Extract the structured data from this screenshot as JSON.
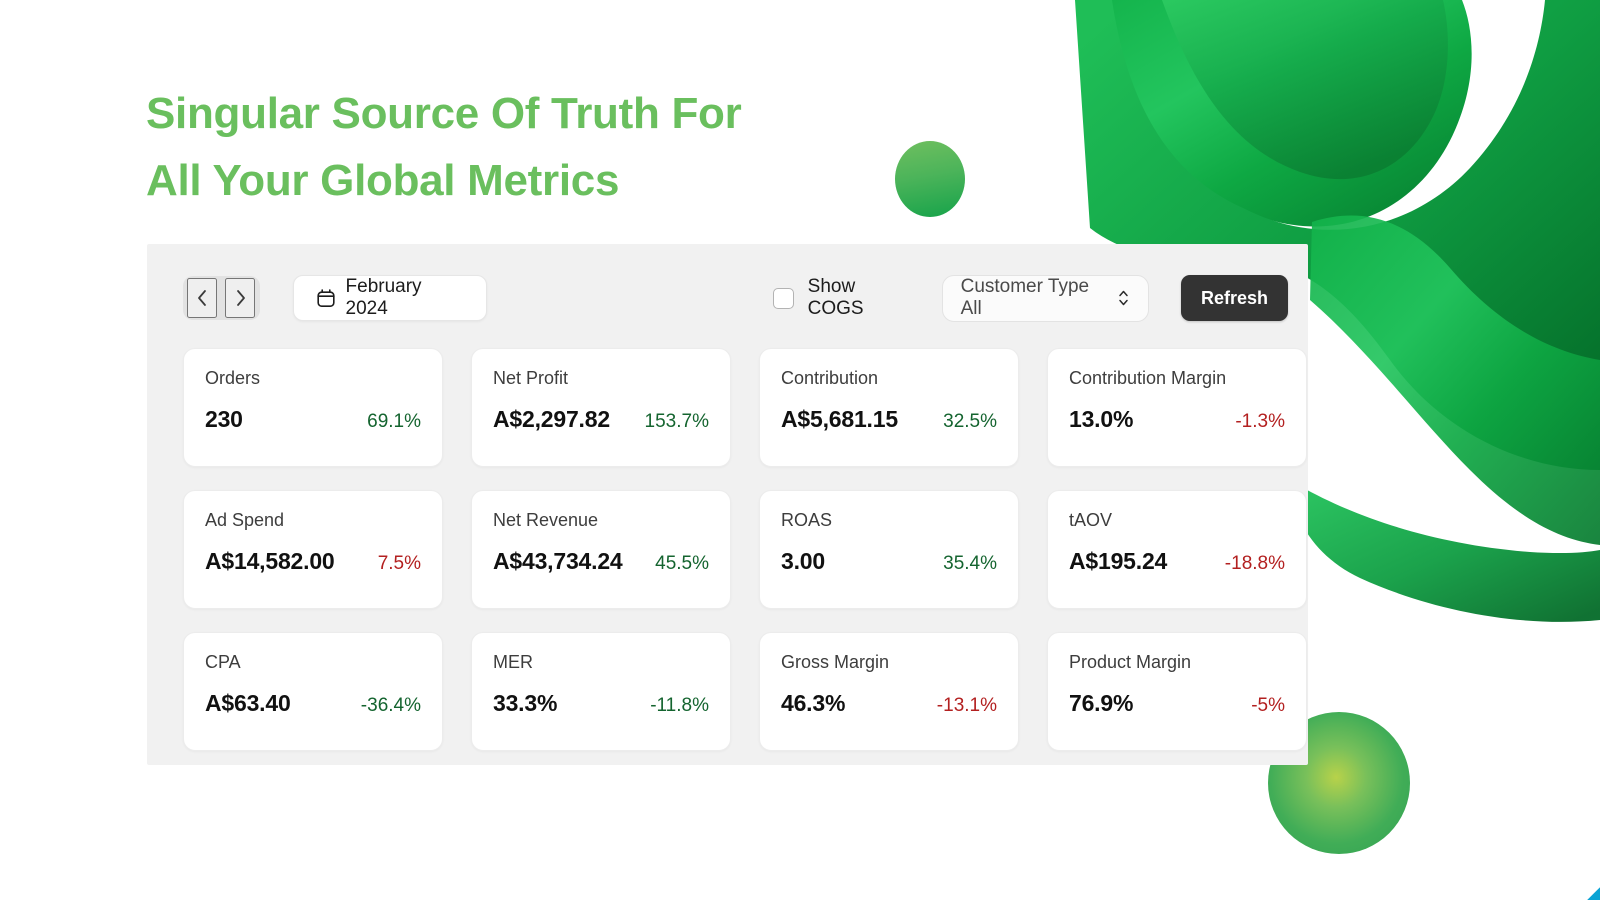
{
  "hero": {
    "headline": "Singular Source Of Truth For\nAll Your Global Metrics",
    "headline_color": "#6abf5e"
  },
  "decor": {
    "circle_small": "green-gradient-circle",
    "circle_large": "green-radial-circle",
    "ribbon": "green-wave-ribbon",
    "corner_mark": "blue-corner-fragment"
  },
  "dashboard": {
    "toolbar": {
      "prev_label": "‹",
      "next_label": "›",
      "prev_icon": "chevron-left-icon",
      "next_icon": "chevron-right-icon",
      "calendar_icon": "calendar-icon",
      "date_value": "February 2024",
      "cogs_label": "Show COGS",
      "cogs_checked": false,
      "customer_type_value": "Customer Type All",
      "select_icon": "chevron-up-down-icon",
      "refresh_label": "Refresh",
      "refresh_bg": "#333333"
    },
    "positive_color": "#14642f",
    "negative_color": "#b32020",
    "metrics": [
      {
        "label": "Orders",
        "value": "230",
        "delta": "69.1%",
        "direction": "up"
      },
      {
        "label": "Net Profit",
        "value": "A$2,297.82",
        "delta": "153.7%",
        "direction": "up"
      },
      {
        "label": "Contribution",
        "value": "A$5,681.15",
        "delta": "32.5%",
        "direction": "up"
      },
      {
        "label": "Contribution Margin",
        "value": "13.0%",
        "delta": "-1.3%",
        "direction": "down"
      },
      {
        "label": "Ad Spend",
        "value": "A$14,582.00",
        "delta": "7.5%",
        "direction": "down"
      },
      {
        "label": "Net Revenue",
        "value": "A$43,734.24",
        "delta": "45.5%",
        "direction": "up"
      },
      {
        "label": "ROAS",
        "value": "3.00",
        "delta": "35.4%",
        "direction": "up"
      },
      {
        "label": "tAOV",
        "value": "A$195.24",
        "delta": "-18.8%",
        "direction": "down"
      },
      {
        "label": "CPA",
        "value": "A$63.40",
        "delta": "-36.4%",
        "direction": "up"
      },
      {
        "label": "MER",
        "value": "33.3%",
        "delta": "-11.8%",
        "direction": "up"
      },
      {
        "label": "Gross Margin",
        "value": "46.3%",
        "delta": "-13.1%",
        "direction": "down"
      },
      {
        "label": "Product Margin",
        "value": "76.9%",
        "delta": "-5%",
        "direction": "down"
      }
    ]
  }
}
